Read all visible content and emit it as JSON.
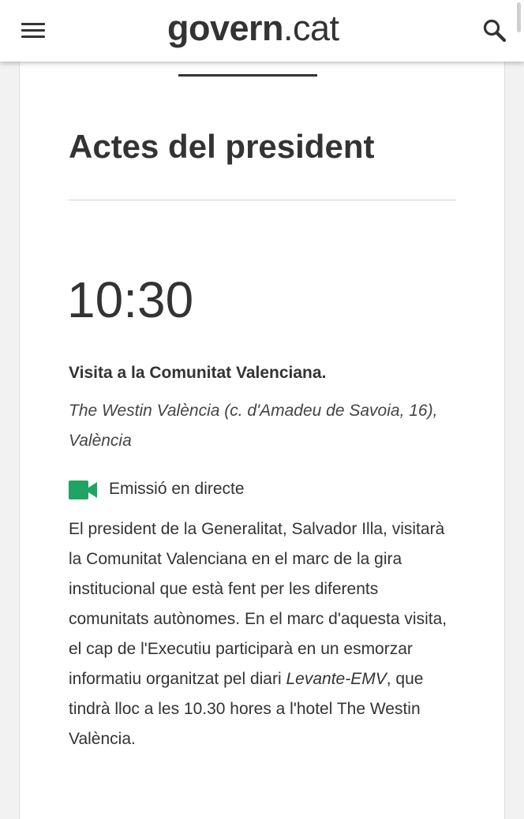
{
  "header": {
    "logo_main": "govern",
    "logo_suffix": ".cat",
    "menu_icon": "hamburger-menu-icon",
    "search_icon": "search-icon"
  },
  "page": {
    "title": "Actes del president"
  },
  "event": {
    "time": "10:30",
    "title": "Visita a la Comunitat Valenciana.",
    "location": "The Westin València (c. d'Amadeu de Savoia, 16), València",
    "stream_icon": "video-camera-icon",
    "stream_color": "#1fa463",
    "stream_label": "Emissió en directe",
    "description_before": "El president de la Generalitat, Salvador Illa, visitarà la Comunitat Valenciana en el marc de la gira institucional que està fent per les diferents comunitats autònomes. En el marc d'aquesta visita, el cap de l'Executiu participarà en un esmorzar informatiu organitzat pel diari ",
    "description_italic": "Levante-EMV",
    "description_after": ", que tindrà lloc a les 10.30 hores a l'hotel The Westin València."
  }
}
